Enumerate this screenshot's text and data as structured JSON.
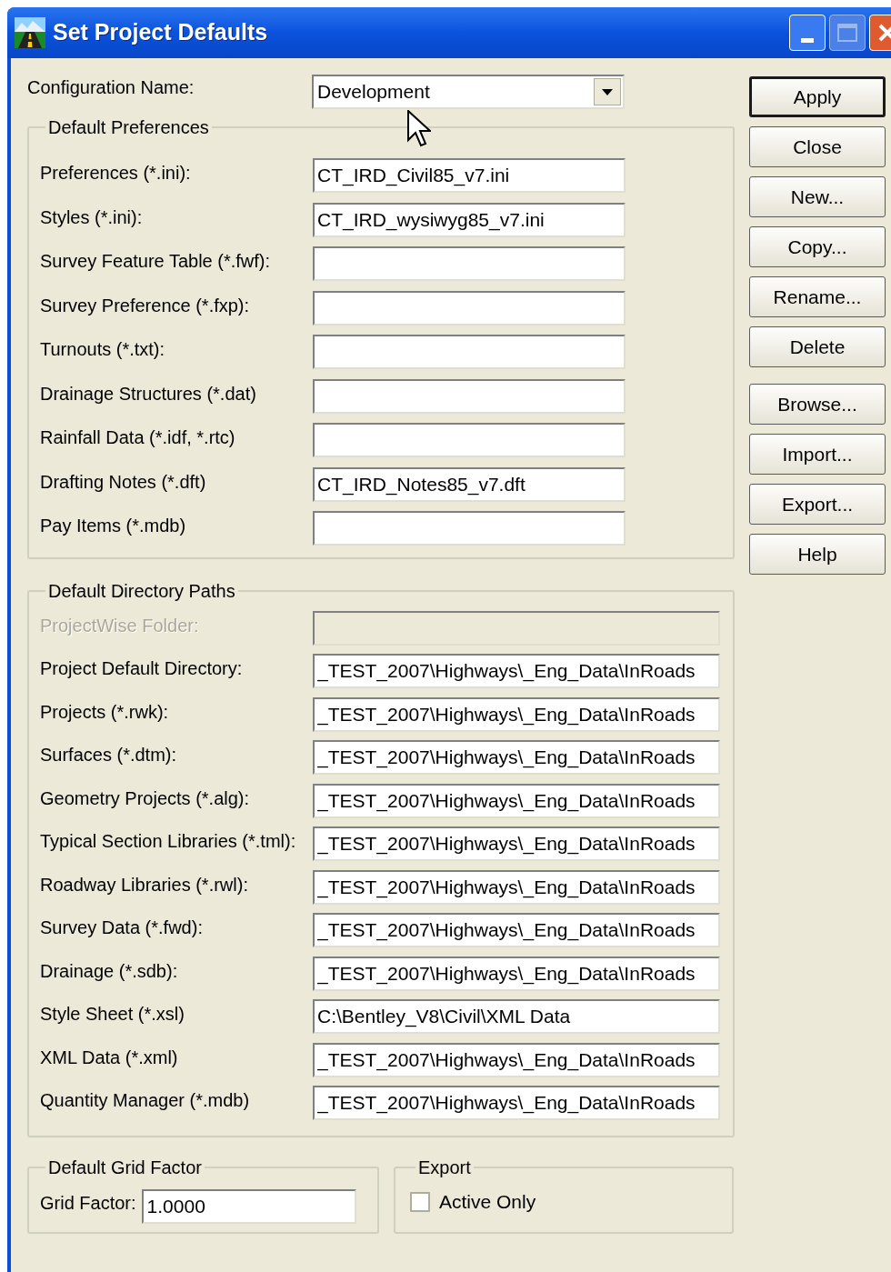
{
  "window": {
    "title": "Set Project Defaults"
  },
  "configuration": {
    "label": "Configuration Name:",
    "value": "Development"
  },
  "preferences": {
    "title": "Default Preferences",
    "rows": [
      {
        "label": "Preferences (*.ini):",
        "value": "CT_IRD_Civil85_v7.ini"
      },
      {
        "label": "Styles (*.ini):",
        "value": "CT_IRD_wysiwyg85_v7.ini"
      },
      {
        "label": "Survey Feature Table (*.fwf):"
      },
      {
        "label": "Survey Preference (*.fxp):"
      },
      {
        "label": "Turnouts (*.txt):"
      },
      {
        "label": "Drainage Structures (*.dat)"
      },
      {
        "label": "Rainfall Data (*.idf, *.rtc)"
      },
      {
        "label": "Drafting Notes (*.dft)",
        "value": "CT_IRD_Notes85_v7.dft"
      },
      {
        "label": "Pay Items (*.mdb)"
      }
    ]
  },
  "directories": {
    "title": "Default Directory Paths",
    "rows": [
      {
        "label": "ProjectWise Folder:",
        "disabled": true
      },
      {
        "label": "Project Default Directory:",
        "value": "_TEST_2007\\Highways\\_Eng_Data\\InRoads",
        "disabled": false
      },
      {
        "label": "Projects (*.rwk):",
        "value": "_TEST_2007\\Highways\\_Eng_Data\\InRoads",
        "disabled": false
      },
      {
        "label": "Surfaces (*.dtm):",
        "value": "_TEST_2007\\Highways\\_Eng_Data\\InRoads",
        "disabled": false
      },
      {
        "label": "Geometry Projects (*.alg):",
        "value": "_TEST_2007\\Highways\\_Eng_Data\\InRoads",
        "disabled": false
      },
      {
        "label": "Typical Section Libraries (*.tml):",
        "value": "_TEST_2007\\Highways\\_Eng_Data\\InRoads",
        "disabled": false
      },
      {
        "label": "Roadway Libraries (*.rwl):",
        "value": "_TEST_2007\\Highways\\_Eng_Data\\InRoads",
        "disabled": false
      },
      {
        "label": "Survey Data (*.fwd):",
        "value": "_TEST_2007\\Highways\\_Eng_Data\\InRoads",
        "disabled": false
      },
      {
        "label": "Drainage (*.sdb):",
        "value": "_TEST_2007\\Highways\\_Eng_Data\\InRoads",
        "disabled": false
      },
      {
        "label": "Style Sheet (*.xsl)",
        "value": "C:\\Bentley_V8\\Civil\\XML Data",
        "disabled": false
      },
      {
        "label": "XML Data (*.xml)",
        "value": "_TEST_2007\\Highways\\_Eng_Data\\InRoads",
        "disabled": false
      },
      {
        "label": "Quantity Manager (*.mdb)",
        "value": "_TEST_2007\\Highways\\_Eng_Data\\InRoads",
        "disabled": false
      }
    ]
  },
  "grid_factor": {
    "title": "Default Grid Factor",
    "label": "Grid Factor:",
    "value": "1.0000"
  },
  "export": {
    "title": "Export",
    "checkbox": {
      "label": "Active Only",
      "checked": false
    }
  },
  "buttons": [
    {
      "label": "Apply",
      "default": true
    },
    {
      "label": "Close",
      "default": false
    },
    {
      "label": "New...",
      "default": false
    },
    {
      "label": "Copy...",
      "default": false
    },
    {
      "label": "Rename...",
      "default": false
    },
    {
      "label": "Delete",
      "default": false
    },
    {
      "label": "Browse...",
      "default": false
    },
    {
      "label": "Import...",
      "default": false
    },
    {
      "label": "Export...",
      "default": false
    },
    {
      "label": "Help",
      "default": false
    }
  ]
}
